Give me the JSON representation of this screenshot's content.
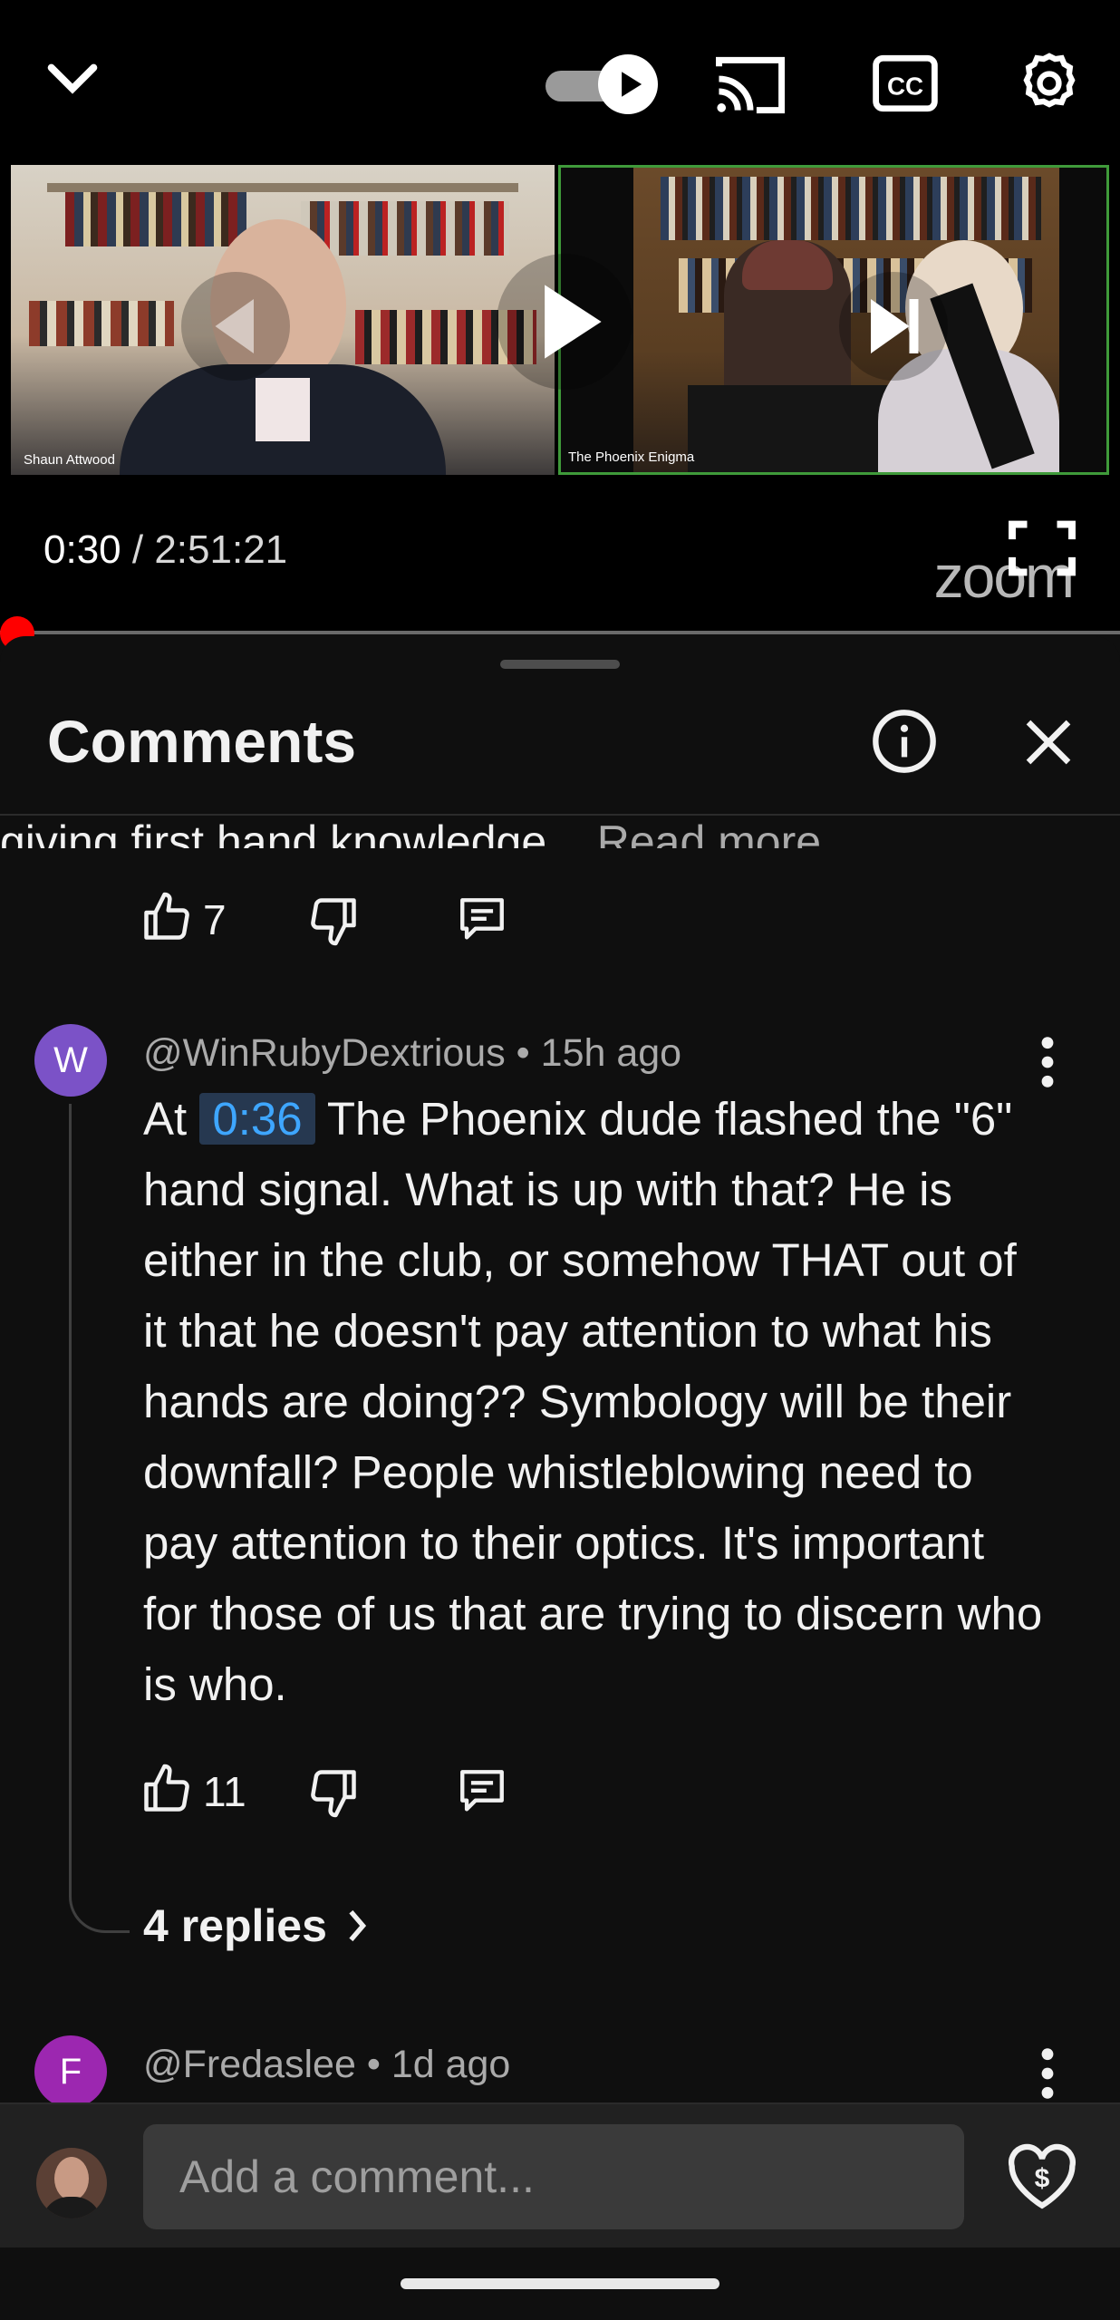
{
  "player": {
    "current_time": "0:30",
    "separator": " / ",
    "duration": "2:51:21",
    "left_speaker_label": "Shaun Attwood",
    "right_speaker_label": "The Phoenix Enigma",
    "zoom_watermark": "zoom",
    "icons": [
      "chevron-down-icon",
      "autoplay-toggle-icon",
      "cast-icon",
      "captions-icon",
      "settings-icon",
      "play-icon",
      "previous-icon",
      "next-icon",
      "fullscreen-icon"
    ],
    "progress_fraction": 0.0029
  },
  "sheet": {
    "title": "Comments"
  },
  "prev_comment": {
    "text_fragment": "giving first hand knowledge...",
    "read_more": "Read more",
    "likes": "7"
  },
  "comment": {
    "avatar_letter": "W",
    "avatar_color": "#7b52c7",
    "author": "@WinRubyDextrious",
    "time": "15h ago",
    "text_before": "At",
    "timestamp_link": "0:36",
    "text_after": "The Phoenix dude flashed the \"6\" hand signal. What is up with that? He is either in the club, or somehow THAT out of it that he doesn't pay attention to what his hands are doing?? Symbology will be their downfall? People whistleblowing need to pay attention to their optics. It's important for those of us that are trying to discern who is who.",
    "likes": "11",
    "replies": "4 replies"
  },
  "next_comment": {
    "avatar_letter": "F",
    "avatar_color": "#9c27b0",
    "author": "@Fredaslee",
    "time": "1d ago"
  },
  "composer": {
    "placeholder": "Add a comment..."
  },
  "colors": {
    "background": "#0f0f0f",
    "accent_link": "#3ea6ff",
    "progress_red": "#ff0000"
  }
}
